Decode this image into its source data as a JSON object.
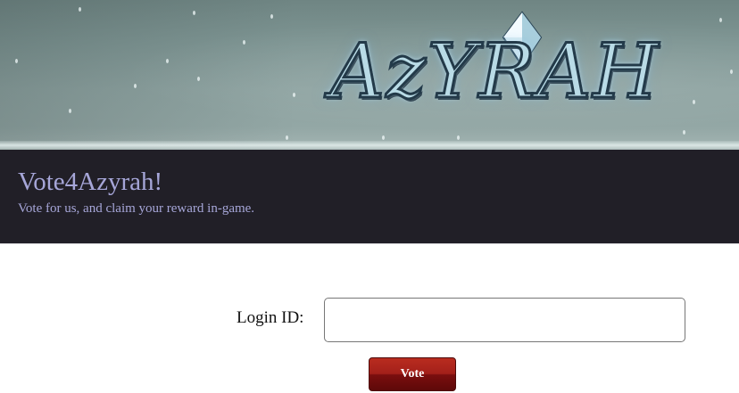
{
  "banner": {
    "logo_text": "AzYRAH",
    "logo_icon": "crystal-icon"
  },
  "header": {
    "title": "Vote4Azyrah!",
    "subtitle": "Vote for us, and claim your reward in-game."
  },
  "form": {
    "login_label": "Login ID:",
    "login_value": "",
    "vote_label": "Vote"
  },
  "colors": {
    "header_bg": "#211f27",
    "header_text": "#a6a6d8",
    "button_red": "#a3201a"
  }
}
